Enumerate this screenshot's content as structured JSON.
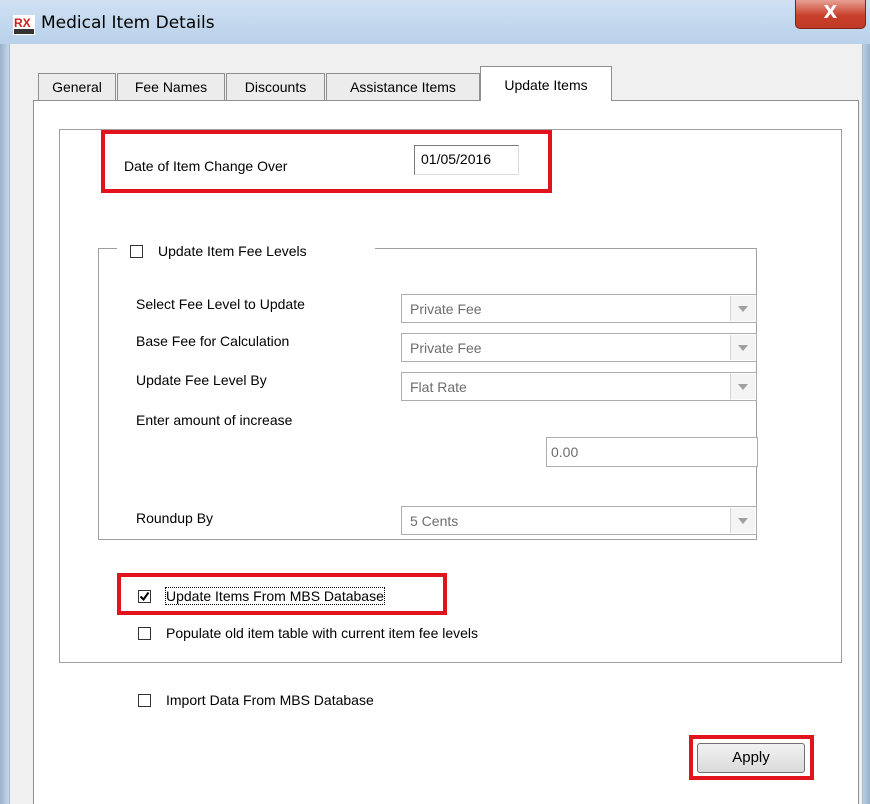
{
  "window": {
    "title": "Medical Item Details",
    "close_label": "X",
    "logo_text": "RX"
  },
  "tabs": [
    {
      "label": "General",
      "active": false
    },
    {
      "label": "Fee Names",
      "active": false
    },
    {
      "label": "Discounts",
      "active": false
    },
    {
      "label": "Assistance Items",
      "active": false
    },
    {
      "label": "Update Items",
      "active": true
    }
  ],
  "update_items": {
    "date_label": "Date of Item Change Over",
    "date_value": "01/05/2016",
    "fee_levels_group": {
      "checkbox_label": "Update Item Fee Levels",
      "checked": false,
      "select_fee_level_label": "Select Fee Level to Update",
      "select_fee_level_value": "Private Fee",
      "base_fee_label": "Base Fee for Calculation",
      "base_fee_value": "Private Fee",
      "update_by_label": "Update Fee Level By",
      "update_by_value": "Flat Rate",
      "amount_label": "Enter amount of increase",
      "amount_value": "0.00",
      "roundup_label": "Roundup By",
      "roundup_value": "5 Cents"
    },
    "update_from_mbs_label": "Update Items From MBS Database",
    "update_from_mbs_checked": true,
    "populate_old_label": "Populate old item table with current item fee levels",
    "populate_old_checked": false,
    "import_data_label": "Import Data From MBS Database",
    "import_data_checked": false,
    "apply_label": "Apply"
  },
  "colors": {
    "highlight": "#e1141e",
    "titlebar": "#b9d1ea",
    "close_button": "#c7402b"
  }
}
